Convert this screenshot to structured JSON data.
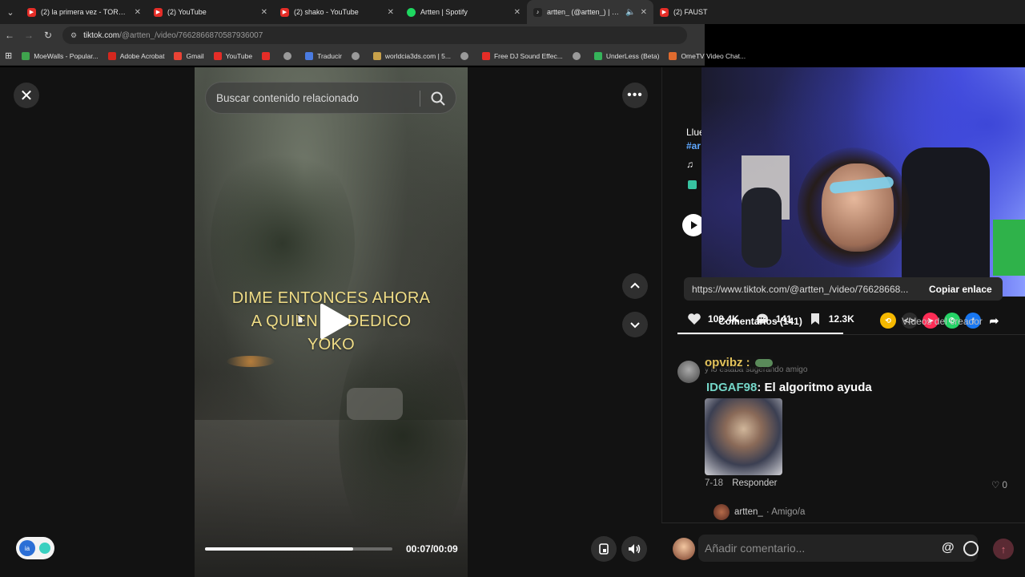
{
  "browser": {
    "tabs": [
      {
        "title": "(2) la primera vez - TORRRES x",
        "favicon_color": "#e52d27",
        "active": false
      },
      {
        "title": "(2) YouTube",
        "favicon_color": "#e52d27",
        "active": false
      },
      {
        "title": "(2) shako - YouTube",
        "favicon_color": "#e52d27",
        "active": false
      },
      {
        "title": "Artten | Spotify",
        "favicon_color": "#1ed760",
        "active": false
      },
      {
        "title": "artten_ (@artten_) | TikTok",
        "favicon_color": "#222222",
        "active": true
      },
      {
        "title": "(2) FAUST",
        "favicon_color": "#e52d27",
        "active": false
      }
    ],
    "address": {
      "domain": "tiktok.com",
      "path": "/@artten_/video/7662866870587936007"
    },
    "bookmarks": [
      {
        "label": "MoeWalls - Popular...",
        "color": "#3fa34d"
      },
      {
        "label": "Adobe Acrobat",
        "color": "#d4271e"
      },
      {
        "label": "Gmail",
        "color": "#ea4335"
      },
      {
        "label": "YouTube",
        "color": "#e52d27"
      },
      {
        "label": "",
        "color": "#e52d27"
      },
      {
        "label": "",
        "color": "#9a9a9a"
      },
      {
        "label": "Traducir",
        "color": "#4a7be0"
      },
      {
        "label": "",
        "color": "#9a9a9a"
      },
      {
        "label": "worldcia3ds.com | 5...",
        "color": "#c8a14a"
      },
      {
        "label": "",
        "color": "#9a9a9a"
      },
      {
        "label": "Free DJ Sound Effec...",
        "color": "#e52d27"
      },
      {
        "label": "",
        "color": "#9a9a9a"
      },
      {
        "label": "UnderLess (Beta)",
        "color": "#35b35a"
      },
      {
        "label": "OmeTV Video Chat...",
        "color": "#e06b2e"
      }
    ]
  },
  "player": {
    "search_placeholder": "Buscar contenido relacionado",
    "overlay_lines": [
      "DIME ENTONCES AHORA",
      "A QUIEN LE DEDICO",
      "YOKO"
    ],
    "time": "00:07/00:09",
    "progress": 0.79
  },
  "panel": {
    "desc_fragment": "Llue",
    "hashtag_fragment": "#ar",
    "stats": {
      "likes": "109.4K",
      "comments": "141",
      "saves": "12.3K"
    },
    "share_colors": [
      "#f5b800",
      "#2c2c2c",
      "#fe2c55",
      "#25d366",
      "#1877f2",
      "#121212"
    ],
    "link": "https://www.tiktok.com/@artten_/video/76628668...",
    "copy_label": "Copiar enlace",
    "tabs": [
      "Comentarios (141)",
      "Vídeos del creador"
    ],
    "comment": {
      "date": "7-18",
      "reply_label": "Responder",
      "likes": "0",
      "reply_user": "artten_",
      "reply_sub": "· Amigo/a"
    },
    "compose_placeholder": "Añadir comentario..."
  },
  "stream_chat": {
    "msg1_user": "opvibz :",
    "ghost_text": "y lo estaba sugerando amigo",
    "msg2_user": "IDGAF98",
    "msg2_text": ": El algoritmo ayuda"
  }
}
